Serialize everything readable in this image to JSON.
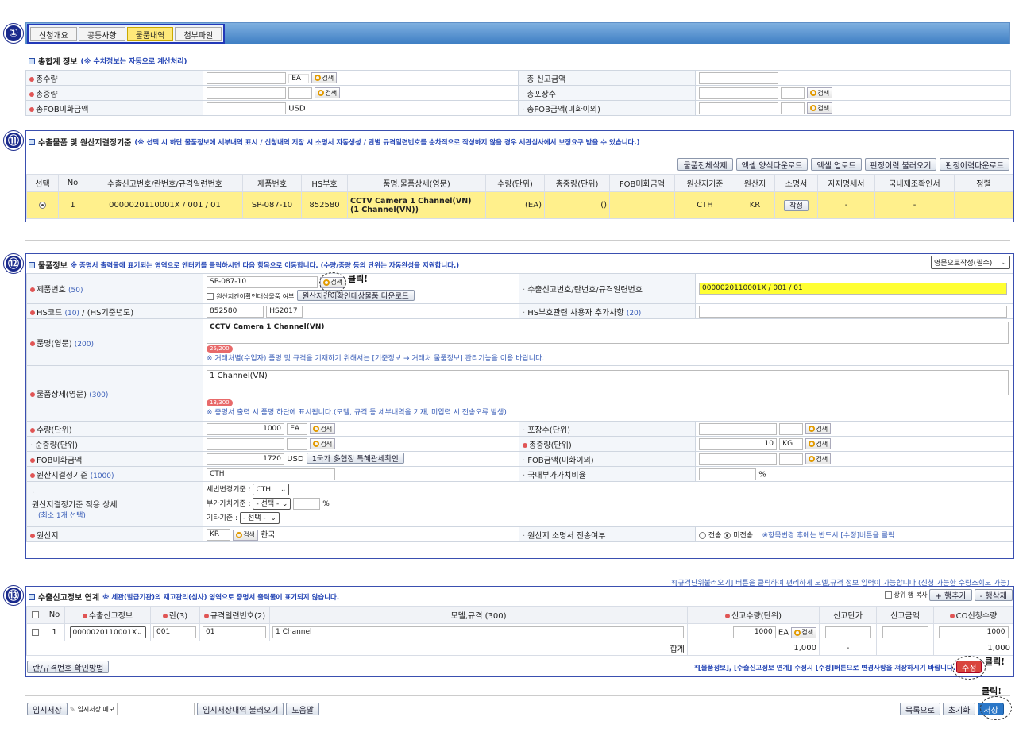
{
  "tabs": [
    "신청개요",
    "공통사항",
    "물품내역",
    "첨부파일"
  ],
  "markers": {
    "m1": "①",
    "m11": "⑪",
    "m12": "⑫",
    "m13": "⑬"
  },
  "search_label": "검색",
  "total": {
    "title": "총합계 정보",
    "note": "(※ 수치정보는 자동으로 계산처리)",
    "qty_label": "총수량",
    "qty_unit": "EA",
    "weight_label": "총중량",
    "fob_label": "총FOB미화금액",
    "fob_unit": "USD",
    "declared_label": "총 신고금액",
    "packages_label": "총포장수",
    "fob_other_label": "총FOB금액(미화이외)"
  },
  "goods": {
    "title": "수출물품 및 원산지결정기준",
    "note": "(※ 선택 시 하단 물품정보에 세부내역 표시 / 신청내역 저장 시 소명서 자동생성 / 관별 규격일련번호를 순차적으로 작성하지 않을 경우 세관심사에서 보정요구 받을 수 있습니다.)",
    "buttons": [
      "물품전체삭제",
      "엑셀 양식다운로드",
      "엑셀 업로드",
      "판정이력 불러오기",
      "판정이력다운로드"
    ],
    "headers": [
      "선택",
      "No",
      "수출신고번호/란번호/규격일련번호",
      "제품번호",
      "HS부호",
      "품명.물품상세(영문)",
      "수량(단위)",
      "총중량(단위)",
      "FOB미화금액",
      "원산지기준",
      "원산지",
      "소명서",
      "자재명세서",
      "국내제조확인서",
      "정렬"
    ],
    "row": {
      "no": "1",
      "decl": "0000020110001X / 001 / 01",
      "product": "SP-087-10",
      "hs": "852580",
      "name1": "CCTV Camera 1 Channel(VN)",
      "name2": "(1 Channel(VN))",
      "qty": "(EA)",
      "weight": "()",
      "fob": "",
      "criteria": "CTH",
      "origin": "KR",
      "write": "작성",
      "bom": "-",
      "domestic": "-"
    }
  },
  "item": {
    "title": "물품정보",
    "note": "※ 증명서 출력물에 표기되는 영역으로 엔터키를 클릭하시면 다음 항목으로 이동합니다. (수량/중량 등의 단위는 자동완성을 지원합니다.)",
    "lang_select": "영문으로작성(필수)",
    "product_label": "제품번호",
    "product_len": "(50)",
    "product_value": "SP-087-10",
    "confirm_check": "원산지간이확인대상물품 여부",
    "confirm_dl": "원산지간이확인대상물품 다운로드",
    "decl_label": "수출신고번호/란번호/규격일련번호",
    "decl_value": "0000020110001X / 001 / 01",
    "hs_label": "HS코드",
    "hs_len": "(10)",
    "hs_year_label": "/ (HS기준년도)",
    "hs_value": "852580",
    "hs_year": "HS2017",
    "hs_user_label": "HS부호관련 사용자 추가사항",
    "hs_user_len": "(20)",
    "name_label": "품명(영문)",
    "name_len": "(200)",
    "name_value": "CCTV Camera 1 Channel(VN)",
    "name_count": "25/200",
    "name_hint": "※ 거래처별(수입자) 품명 및 규격을 기재하기 위해서는 [기준정보 → 거래처 물품정보] 관리기능을 이용 바랍니다.",
    "detail_label": "물품상세(영문)",
    "detail_len": "(300)",
    "detail_value": "1 Channel(VN)",
    "detail_count": "13/300",
    "detail_hint": "※ 증명서 출력 시 품명 하단에 표시됩니다.(모델, 규격 등 세부내역을 기재, 미입력 시 전송오류 발생)",
    "qty_label": "수량(단위)",
    "qty_value": "1000",
    "qty_unit": "EA",
    "pkg_label": "포장수(단위)",
    "net_label": "순중량(단위)",
    "gross_label": "총중량(단위)",
    "gross_value": "10",
    "gross_unit": "KG",
    "fob_label": "FOB미화금액",
    "fob_value": "1720",
    "fob_unit": "USD",
    "fta_btn": "1국가 多협정 특혜관세확인",
    "fob_other_label": "FOB금액(미화이외)",
    "criteria_label": "원산지결정기준",
    "criteria_len": "(1000)",
    "criteria_value": "CTH",
    "domestic_label": "국내부가가치비율",
    "pct": "%",
    "apply_label": "원산지결정기준 적용 상세",
    "apply_sub": "(최소 1개 선택)",
    "tariff_label": "세번변경기준 :",
    "tariff_value": "CTH",
    "value_label": "부가가치기준 :",
    "value_value": "- 선택 -",
    "other_label": "기타기준 :",
    "other_value": "- 선택 -",
    "origin_label": "원산지",
    "origin_code": "KR",
    "origin_name": "한국",
    "send_label": "원산지 소명서 전송여부",
    "send_opt1": "전송",
    "send_opt2": "미전송",
    "send_note": "※항목변경 후에는 반드시 [수정]버튼을 클릭"
  },
  "link": {
    "top_note": "*[규격단위불러오기] 버튼을 클릭하여 편리하게 모델,규격 정보 입력이 가능합니다.(신청 가능한 수량조회도 가능)",
    "title": "수출신고정보 연계",
    "note": "※ 세관(발급기관)의 재고관리(심사) 영역으로 증명서 출력물에 표기되지 않습니다.",
    "copy_label": "상위 행 복사",
    "add_btn": "+ 행추가",
    "del_btn": "- 행삭제",
    "headers": [
      "No",
      "수출신고정보",
      "란(3)",
      "규격일련번호(2)",
      "모델,규격 (300)",
      "신고수량(단위)",
      "신고단가",
      "신고금액",
      "CO신청수량"
    ],
    "row": {
      "no": "1",
      "decl": "0000020110001X",
      "ran": "001",
      "seq": "01",
      "model": "1 Channel",
      "qty": "1000",
      "unit": "EA",
      "co": "1000"
    },
    "sum_label": "합계",
    "sum_qty": "1,000",
    "sum_amt": "-",
    "sum_co": "1,000",
    "howto_btn": "란/규격번호 확인방법",
    "save_note": "*[물품정보], [수출신고정보 연계] 수정시 [수정]버튼으로 변경사항을 저장하시기 바랍니다.",
    "modify_btn": "수정"
  },
  "footer": {
    "temp_save": "임시저장",
    "memo_label": "임시저장 메모",
    "load_btn": "임시저장내역 불러오기",
    "help_btn": "도움말",
    "list_btn": "목록으로",
    "reset_btn": "초기화",
    "save_btn": "저장"
  },
  "click_text": "클릭!"
}
